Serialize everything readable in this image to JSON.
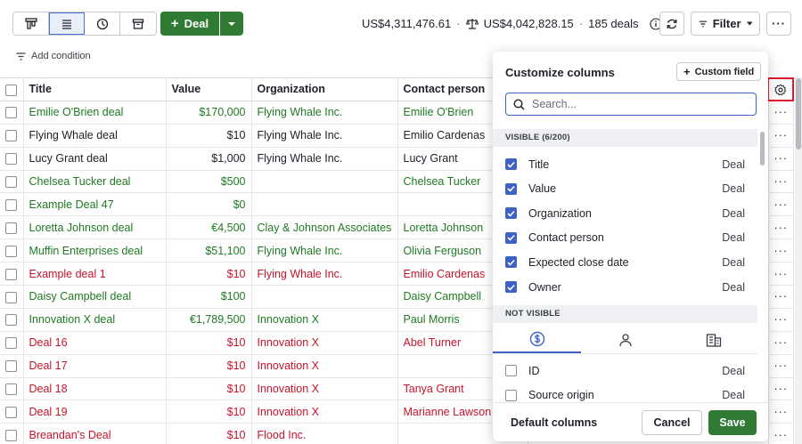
{
  "toolbar": {
    "views": [
      {
        "name": "pipeline-view"
      },
      {
        "name": "list-view",
        "active": true
      },
      {
        "name": "forecast-view"
      },
      {
        "name": "archive-view"
      }
    ],
    "add_deal_label": "Deal",
    "total_value": "US$4,311,476.61",
    "weighted_value": "US$4,042,828.15",
    "deal_count": "185 deals",
    "filter_label": "Filter",
    "add_condition_label": "Add condition"
  },
  "table": {
    "columns": [
      "Title",
      "Value",
      "Organization",
      "Contact person"
    ],
    "rows": [
      {
        "title": "Emilie O'Brien deal",
        "value": "$170,000",
        "org": "Flying Whale Inc.",
        "contact": "Emilie O'Brien",
        "status": "green"
      },
      {
        "title": "Flying Whale deal",
        "value": "$10",
        "org": "Flying Whale Inc.",
        "contact": "Emilio Cardenas",
        "status": "dark"
      },
      {
        "title": "Lucy Grant deal",
        "value": "$1,000",
        "org": "Flying Whale Inc.",
        "contact": "Lucy Grant",
        "status": "dark"
      },
      {
        "title": "Chelsea Tucker deal",
        "value": "$500",
        "org": "",
        "contact": "Chelsea Tucker",
        "status": "green"
      },
      {
        "title": "Example Deal 47",
        "value": "$0",
        "org": "",
        "contact": "",
        "status": "green"
      },
      {
        "title": "Loretta Johnson deal",
        "value": "€4,500",
        "org": "Clay & Johnson Associates",
        "contact": "Loretta Johnson",
        "status": "green"
      },
      {
        "title": "Muffin Enterprises deal",
        "value": "$51,100",
        "org": "Flying Whale Inc.",
        "contact": "Olivia Ferguson",
        "status": "green"
      },
      {
        "title": "Example deal 1",
        "value": "$10",
        "org": "Flying Whale Inc.",
        "contact": "Emilio Cardenas",
        "status": "red"
      },
      {
        "title": "Daisy Campbell deal",
        "value": "$100",
        "org": "",
        "contact": "Daisy Campbell",
        "status": "green"
      },
      {
        "title": "Innovation X deal",
        "value": "€1,789,500",
        "org": "Innovation X",
        "contact": "Paul Morris",
        "status": "green"
      },
      {
        "title": "Deal 16",
        "value": "$10",
        "org": "Innovation X",
        "contact": "Abel Turner",
        "status": "red"
      },
      {
        "title": "Deal 17",
        "value": "$10",
        "org": "Innovation X",
        "contact": "",
        "status": "red"
      },
      {
        "title": "Deal 18",
        "value": "$10",
        "org": "Innovation X",
        "contact": "Tanya Grant",
        "status": "red"
      },
      {
        "title": "Deal 19",
        "value": "$10",
        "org": "Innovation X",
        "contact": "Marianne Lawson",
        "status": "red"
      },
      {
        "title": "Breandan's Deal",
        "value": "$10",
        "org": "Flood Inc.",
        "contact": "",
        "status": "red"
      }
    ],
    "row_menu_label": "···"
  },
  "panel": {
    "title": "Customize columns",
    "custom_field_label": "Custom field",
    "search_placeholder": "Search...",
    "visible_header": "VISIBLE (6/200)",
    "visible_items": [
      {
        "label": "Title",
        "group": "Deal"
      },
      {
        "label": "Value",
        "group": "Deal"
      },
      {
        "label": "Organization",
        "group": "Deal"
      },
      {
        "label": "Contact person",
        "group": "Deal"
      },
      {
        "label": "Expected close date",
        "group": "Deal"
      },
      {
        "label": "Owner",
        "group": "Deal"
      }
    ],
    "not_visible_header": "NOT VISIBLE",
    "not_visible_tabs": [
      "deal-tab",
      "person-tab",
      "organization-tab"
    ],
    "not_visible_items": [
      {
        "label": "ID",
        "group": "Deal"
      },
      {
        "label": "Source origin",
        "group": "Deal"
      }
    ],
    "default_columns_label": "Default columns",
    "cancel_label": "Cancel",
    "save_label": "Save"
  },
  "colors": {
    "green": "#1f7a22",
    "red": "#c8132a",
    "dark": "#21232c",
    "primary_button": "#2f7b33",
    "accent": "#3d62c4",
    "highlight_box": "#e0182d"
  }
}
